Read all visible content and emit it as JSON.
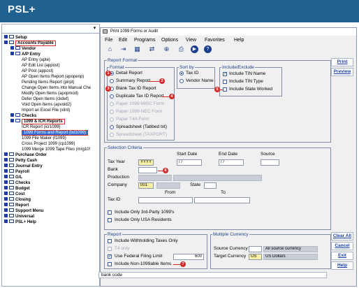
{
  "app": {
    "title": "PSL+"
  },
  "left_panel": {
    "combo_value": "",
    "tree": [
      {
        "label": "Setup",
        "bold": true,
        "type": "folder"
      },
      {
        "label": "Accounts Payable",
        "bold": true,
        "type": "folder",
        "highlight": true
      },
      {
        "label": "Vendor",
        "bold": true,
        "type": "subfolder"
      },
      {
        "label": "A/P Entry",
        "bold": true,
        "type": "subfolder"
      },
      {
        "label": "AP Entry (apte)",
        "type": "leaf"
      },
      {
        "label": "AP Edit List (appost)",
        "type": "leaf"
      },
      {
        "label": "AP Post (appost)",
        "type": "leaf"
      },
      {
        "label": "AP Open Items Report (apopenp)",
        "type": "leaf"
      },
      {
        "label": "Pending Items Report (pirpt)",
        "type": "leaf"
      },
      {
        "label": "Change Open Items into Manual Che",
        "type": "leaf"
      },
      {
        "label": "Modify Open Items (apopmod)",
        "type": "leaf"
      },
      {
        "label": "Defer Open Items (ckdef)",
        "type": "leaf"
      },
      {
        "label": "Void Open Items (apvoid2)",
        "type": "leaf"
      },
      {
        "label": "Import an Excel File (xlint)",
        "type": "leaf"
      },
      {
        "label": "Checks",
        "bold": true,
        "type": "subfolder"
      },
      {
        "label": "1099 & ICR Reports",
        "bold": true,
        "type": "subfolder",
        "highlight": true
      },
      {
        "label": "ICR Report (icr1099)",
        "type": "leaf"
      },
      {
        "label": "1099 Forms and Report (bd1099)",
        "type": "leaf",
        "selected": true
      },
      {
        "label": "1099 File Maker (f1099)",
        "type": "leaf"
      },
      {
        "label": "Cross Project 1099 (cp1099)",
        "type": "leaf"
      },
      {
        "label": "1099 Merge 1099 Tape Files (mrg10!",
        "type": "leaf"
      },
      {
        "label": "Purchase Order",
        "bold": true,
        "type": "folder"
      },
      {
        "label": "Petty Cash",
        "bold": true,
        "type": "folder"
      },
      {
        "label": "Journal Entry",
        "bold": true,
        "type": "folder"
      },
      {
        "label": "Payroll",
        "bold": true,
        "type": "folder"
      },
      {
        "label": "G/L",
        "bold": true,
        "type": "folder"
      },
      {
        "label": "Checks",
        "bold": true,
        "type": "folder"
      },
      {
        "label": "Budget",
        "bold": true,
        "type": "folder"
      },
      {
        "label": "Cost",
        "bold": true,
        "type": "folder"
      },
      {
        "label": "Closing",
        "bold": true,
        "type": "folder"
      },
      {
        "label": "Report",
        "bold": true,
        "type": "folder"
      },
      {
        "label": "Support Menu",
        "bold": true,
        "type": "folder"
      },
      {
        "label": "Universal",
        "bold": true,
        "type": "folder"
      },
      {
        "label": "PSL+ Help",
        "bold": true,
        "type": "folder"
      }
    ]
  },
  "dialog": {
    "title": "Print 1099 Forms or Audit",
    "menu": [
      "File",
      "Edit",
      "Programs",
      "Options",
      "View",
      "Favorites",
      "Help"
    ],
    "report_format": {
      "group_label": "Report Format",
      "format_label": "Format",
      "options": [
        {
          "label": "Detail Report",
          "selected": true,
          "enabled": true,
          "badge": "1"
        },
        {
          "label": "Summary Report",
          "selected": false,
          "enabled": true,
          "badge": "2"
        },
        {
          "label": "Blank Tax ID Report",
          "selected": false,
          "enabled": true,
          "badge": "3"
        },
        {
          "label": "Duplicate Tax ID Report",
          "selected": false,
          "enabled": true,
          "badge": "4"
        },
        {
          "label": "Paper 1099-MISC Form",
          "selected": false,
          "enabled": false
        },
        {
          "label": "Paper 1099-NEC Form",
          "selected": false,
          "enabled": false
        },
        {
          "label": "Paper T4A Form",
          "selected": false,
          "enabled": false
        },
        {
          "label": "Spreadsheet (Tabbed txt)",
          "selected": false,
          "enabled": true
        },
        {
          "label": "Spreadsheet (TAXPORT)",
          "selected": false,
          "enabled": false
        }
      ],
      "sort_by": {
        "label": "Sort by",
        "options": [
          {
            "label": "Tax ID",
            "selected": true
          },
          {
            "label": "Vendor Name",
            "selected": false
          }
        ]
      },
      "include_exclude": {
        "label": "Include/Exclude",
        "options": [
          {
            "label": "Include TIN Name",
            "checked": true
          },
          {
            "label": "Include TIN Type",
            "checked": false
          },
          {
            "label": "Include State Worked",
            "checked": false,
            "badge": "5"
          }
        ]
      }
    },
    "selection_criteria": {
      "label": "Selection Criteria",
      "start_date_label": "Start Date",
      "end_date_label": "End Date",
      "source_label": "Source",
      "tax_year_label": "Tax Year",
      "tax_year_value": "YYYY",
      "start_date_value": "/ /",
      "end_date_value": "/ /",
      "bank_label": "Bank",
      "bank_badge": "6",
      "production_label": "Production",
      "company_label": "Company",
      "company_value": "001",
      "state_label": "State",
      "from_label": "From",
      "to_label": "To",
      "tax_id_label": "Tax ID",
      "only_3rd_party": "Include Only 3rd-Party 1099's",
      "only_usa": "Include Only USA Residents"
    },
    "report": {
      "label": "Report",
      "include_withholding": "Include Withholding Taxes Only",
      "t4_only": "T4 only",
      "use_federal": "Use Federal Filing Limit",
      "federal_limit": "600",
      "non_1099": "Include Non-1099able Items",
      "non_1099_badge": "7"
    },
    "multiple_currency": {
      "label": "Multiple Currency",
      "source_label": "Source Currency",
      "source_value": "All source currency",
      "target_label": "Target Currency",
      "target_code": "US",
      "target_value": "US Dollars"
    },
    "buttons": {
      "print": "Print",
      "preview": "Preview",
      "clear_all": "Clear All",
      "cancel": "Cancel",
      "exit": "Exit",
      "help": "Help"
    },
    "status": "bank code"
  }
}
